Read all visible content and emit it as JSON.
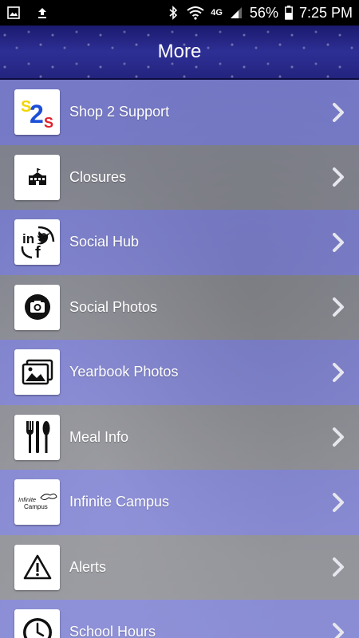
{
  "status_bar": {
    "network_label": "4G",
    "battery_percent": "56%",
    "time": "7:25 PM",
    "icons": [
      "image-icon",
      "upload-icon",
      "bluetooth-icon",
      "wifi-icon",
      "signal-icon",
      "battery-icon"
    ]
  },
  "header": {
    "title": "More"
  },
  "menu": {
    "items": [
      {
        "label": "Shop 2 Support",
        "icon": "s2s-logo-icon",
        "icon_text": [
          "S",
          "2",
          "S"
        ]
      },
      {
        "label": "Closures",
        "icon": "school-building-icon"
      },
      {
        "label": "Social Hub",
        "icon": "social-hub-icon",
        "icon_text": [
          "in",
          "f"
        ]
      },
      {
        "label": "Social Photos",
        "icon": "camera-icon"
      },
      {
        "label": "Yearbook Photos",
        "icon": "photo-gallery-icon"
      },
      {
        "label": "Meal Info",
        "icon": "utensils-icon"
      },
      {
        "label": "Infinite Campus",
        "icon": "infinite-campus-logo-icon",
        "icon_text": [
          "Infinite",
          "Campus"
        ]
      },
      {
        "label": "Alerts",
        "icon": "warning-icon"
      },
      {
        "label": "School Hours",
        "icon": "clock-icon"
      }
    ]
  },
  "colors": {
    "header_bg": "#2e2f95",
    "row_blue": "#6468d2",
    "row_gray": "#6e6e6e",
    "s2s_yellow": "#f2d600",
    "s2s_blue": "#1c4fd8",
    "s2s_red": "#e0202a"
  }
}
